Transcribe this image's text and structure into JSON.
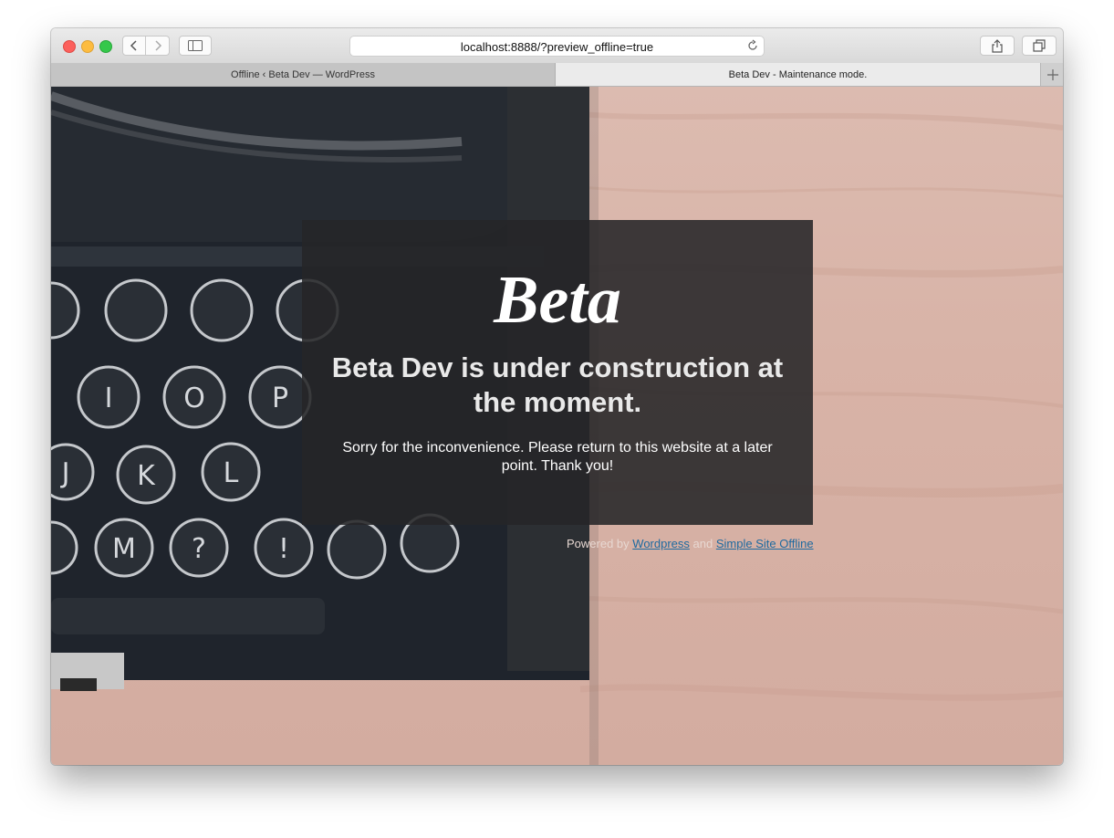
{
  "browser": {
    "url": "localhost:8888/?preview_offline=true",
    "tabs": [
      {
        "label": "Offline ‹ Beta Dev — WordPress"
      },
      {
        "label": "Beta Dev - Maintenance mode."
      }
    ]
  },
  "page": {
    "logo_text": "Beta",
    "headline": "Beta Dev is under construction at the moment.",
    "message": "Sorry for the inconvenience. Please return to this website at a later point. Thank you!",
    "footer": {
      "powered_by": "Powered by",
      "link1": "Wordpress",
      "and": "and",
      "link2": "Simple Site Offline"
    }
  },
  "colors": {
    "card_bg": "#262628",
    "link": "#1e6aa0",
    "wood": "#d8b3a7"
  },
  "icons": [
    "back-icon",
    "forward-icon",
    "sidebar-icon",
    "reload-icon",
    "share-icon",
    "tabs-icon",
    "plus-icon"
  ]
}
